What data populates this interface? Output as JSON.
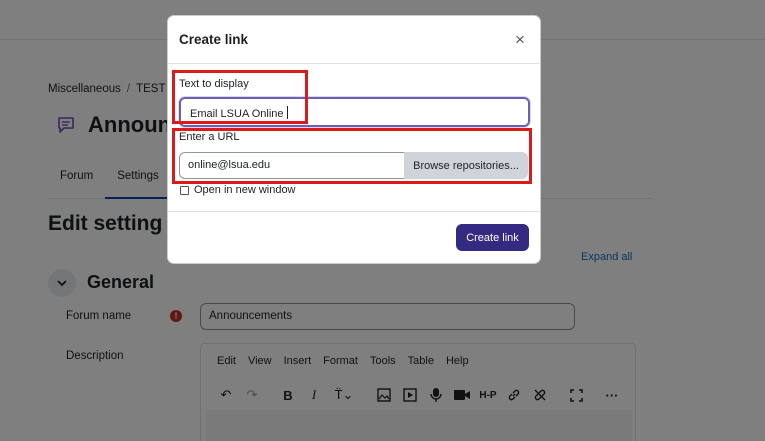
{
  "background": {
    "breadcrumb": [
      "Miscellaneous",
      "TEST C"
    ],
    "page_title": "Announ",
    "tabs": [
      "Forum",
      "Settings",
      "S"
    ],
    "section_title": "Edit setting",
    "expand_all": "Expand all",
    "general_title": "General",
    "forum_name_label": "Forum name",
    "forum_name_value": "Announcements",
    "description_label": "Description",
    "editor_menu": [
      "Edit",
      "View",
      "Insert",
      "Format",
      "Tools",
      "Table",
      "Help"
    ]
  },
  "modal": {
    "title": "Create link",
    "close_glyph": "×",
    "text_label": "Text to display",
    "text_value": "Email LSUA Online",
    "url_label": "Enter a URL",
    "url_value": "online@lsua.edu",
    "browse_label": "Browse repositories...",
    "new_window_label": "Open in new window",
    "submit_label": "Create link"
  },
  "colors": {
    "accent": "#332a82",
    "focus_border": "#6f5fb4",
    "highlight": "#dc1a1a",
    "required": "#ca3120"
  }
}
